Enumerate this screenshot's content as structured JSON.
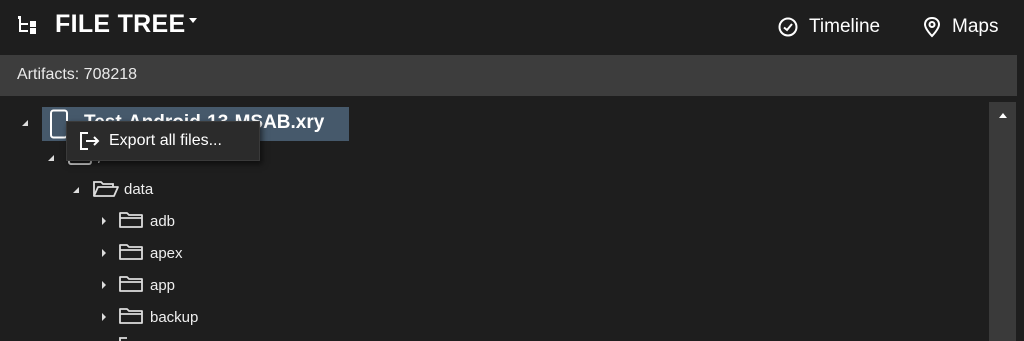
{
  "header": {
    "title": "FILE TREE",
    "nav": [
      {
        "label": "Timeline",
        "icon": "clock-check-icon"
      },
      {
        "label": "Maps",
        "icon": "map-pin-icon"
      }
    ]
  },
  "artifacts": {
    "label": "Artifacts: 708218"
  },
  "tree": {
    "root": {
      "label": "Test-Android-13-MSAB.xry",
      "icon": "phone-icon",
      "expanded": true
    },
    "level1": {
      "label": "/",
      "icon": "drive-icon",
      "expanded": true
    },
    "data_folder": {
      "label": "data",
      "icon": "folder-open-icon",
      "expanded": true
    },
    "children": [
      {
        "label": "adb",
        "icon": "folder-icon",
        "expanded": false
      },
      {
        "label": "apex",
        "icon": "folder-icon",
        "expanded": false
      },
      {
        "label": "app",
        "icon": "folder-icon",
        "expanded": false
      },
      {
        "label": "backup",
        "icon": "folder-icon",
        "expanded": false
      }
    ]
  },
  "context_menu": {
    "items": [
      {
        "label": "Export all files...",
        "icon": "export-icon"
      }
    ]
  },
  "colors": {
    "background": "#1e1e1e",
    "artifacts_bar": "#3d3d3d",
    "selection": "#46596b",
    "scrollbar": "#3a3a3a"
  }
}
